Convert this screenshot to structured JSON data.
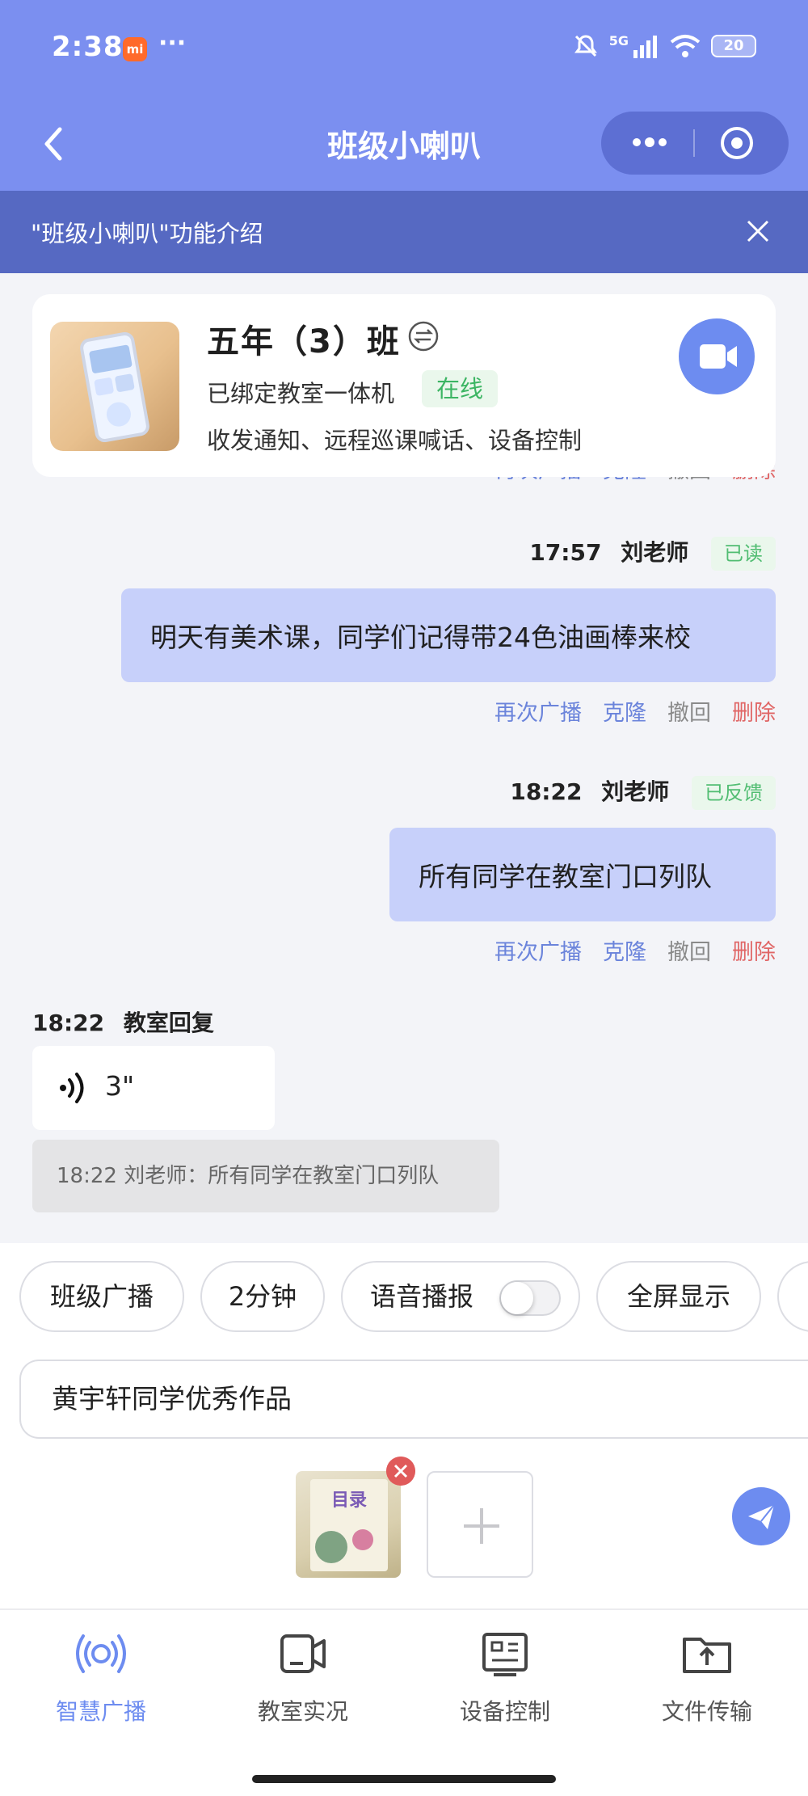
{
  "status_bar": {
    "time": "2:38",
    "app_badge": "mi",
    "more": "···",
    "network": "5G",
    "battery": "20"
  },
  "header": {
    "title": "班级小喇叭"
  },
  "banner": {
    "text": "\"班级小喇叭\"功能介绍"
  },
  "class_card": {
    "name": "五年（3）班",
    "bind_status": "已绑定教室一体机",
    "online": "在线",
    "description": "收发通知、远程巡课喊话、设备控制"
  },
  "messages": [
    {
      "time": "17:57",
      "sender": "刘老师",
      "status": "已读",
      "text": "明天有美术课，同学们记得带24色油画棒来校",
      "actions": [
        "再次广播",
        "克隆",
        "撤回",
        "删除"
      ]
    },
    {
      "time": "18:22",
      "sender": "刘老师",
      "status": "已反馈",
      "text": "所有同学在教室门口列队",
      "actions": [
        "再次广播",
        "克隆",
        "撤回",
        "删除"
      ]
    }
  ],
  "reply": {
    "time": "18:22",
    "from": "教室回复",
    "voice_duration": "3\"",
    "quote": "18:22 刘老师：所有同学在教室门口列队"
  },
  "composer": {
    "chips": [
      "班级广播",
      "2分钟",
      "语音播报",
      "全屏显示"
    ],
    "voice_toggle_on": false,
    "input_value": "黄宇轩同学优秀作品",
    "attachment_title": "目录"
  },
  "tabs": [
    {
      "label": "智慧广播",
      "icon": "broadcast-icon",
      "active": true
    },
    {
      "label": "教室实况",
      "icon": "video-monitor-icon",
      "active": false
    },
    {
      "label": "设备控制",
      "icon": "device-control-icon",
      "active": false
    },
    {
      "label": "文件传输",
      "icon": "folder-upload-icon",
      "active": false
    }
  ],
  "colors": {
    "primary": "#7b8ff0",
    "banner": "#5669c2",
    "bubble": "#c7d0fa",
    "success": "#3cb563",
    "danger": "#e06666"
  }
}
